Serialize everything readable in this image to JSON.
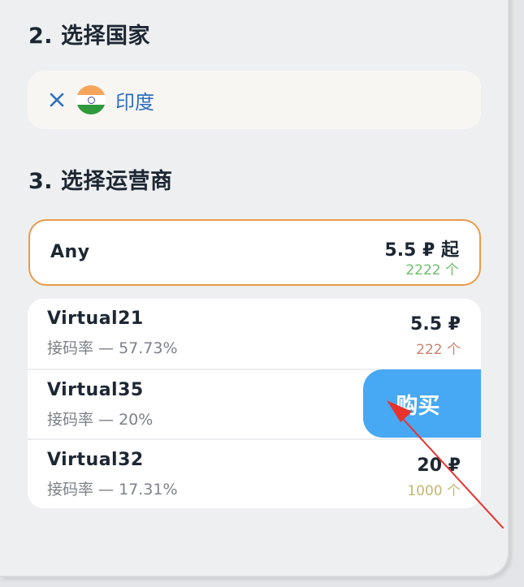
{
  "sections": {
    "country_heading": "2. 选择国家",
    "operator_heading": "3. 选择运营商"
  },
  "country": {
    "name": "印度",
    "flag_icon": "india-flag-icon",
    "remove_icon": "close-icon"
  },
  "any_option": {
    "name": "Any",
    "price": "5.5 ₽ 起",
    "count": "2222 个"
  },
  "operators": [
    {
      "name": "Virtual21",
      "rate": "接码率 — 57.73%",
      "price": "5.5 ₽",
      "count": "222 个"
    },
    {
      "name": "Virtual35",
      "rate": "接码率 — 20%"
    },
    {
      "name": "Virtual32",
      "rate": "接码率 — 17.31%",
      "price": "20 ₽",
      "count": "1000 个"
    }
  ],
  "buy_button": {
    "label": "购买"
  },
  "colors": {
    "accent_border": "#e99b4a",
    "buy_button": "#47a8f3",
    "count_green": "#6cbf6c",
    "count_red": "#c9826f",
    "count_olive": "#c2b870",
    "link_blue": "#2d6fbf",
    "annotation_arrow": "#e8322c"
  }
}
